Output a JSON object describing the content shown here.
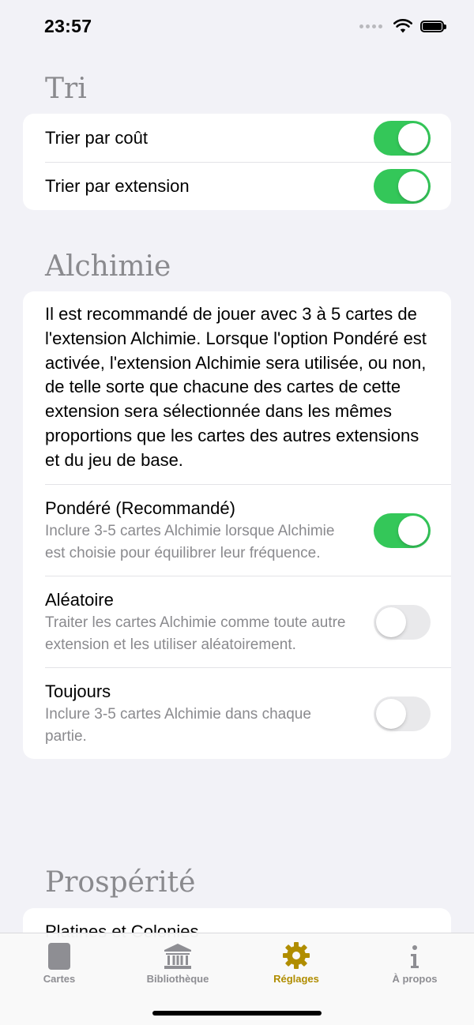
{
  "status_bar": {
    "time": "23:57"
  },
  "sections": {
    "tri": {
      "header": "Tri",
      "rows": [
        {
          "label": "Trier par coût",
          "on": true
        },
        {
          "label": "Trier par extension",
          "on": true
        }
      ]
    },
    "alchimie": {
      "header": "Alchimie",
      "description": "Il est recommandé de jouer avec 3 à 5 cartes de l'extension Alchimie. Lorsque l'option Pondéré est activée, l'extension Alchimie sera utilisée, ou non, de telle sorte que chacune des cartes de cette extension sera sélectionnée dans les mêmes proportions que les cartes des autres extensions et du jeu de base.",
      "options": [
        {
          "title": "Pondéré (Recommandé)",
          "subtitle": "Inclure 3-5 cartes Alchimie lorsque Alchimie est choisie pour équilibrer leur fréquence.",
          "on": true
        },
        {
          "title": "Aléatoire",
          "subtitle": "Traiter les cartes Alchimie comme toute autre extension et les utiliser aléatoirement.",
          "on": false
        },
        {
          "title": "Toujours",
          "subtitle": "Inclure 3-5 cartes Alchimie dans chaque partie.",
          "on": false
        }
      ]
    },
    "prosperite": {
      "header": "Prospérité",
      "rows": [
        {
          "label": "Platines et Colonies"
        }
      ]
    }
  },
  "tab_bar": {
    "tabs": [
      {
        "label": "Cartes",
        "icon": "card-icon",
        "active": false
      },
      {
        "label": "Bibliothèque",
        "icon": "library-icon",
        "active": false
      },
      {
        "label": "Réglages",
        "icon": "gear-icon",
        "active": true
      },
      {
        "label": "À propos",
        "icon": "info-icon",
        "active": false
      }
    ]
  },
  "colors": {
    "toggle_on": "#34c759",
    "toggle_off": "#e9e9eb",
    "tab_active": "#b08d00",
    "tab_inactive": "#8e8e93",
    "background": "#f2f2f7"
  }
}
